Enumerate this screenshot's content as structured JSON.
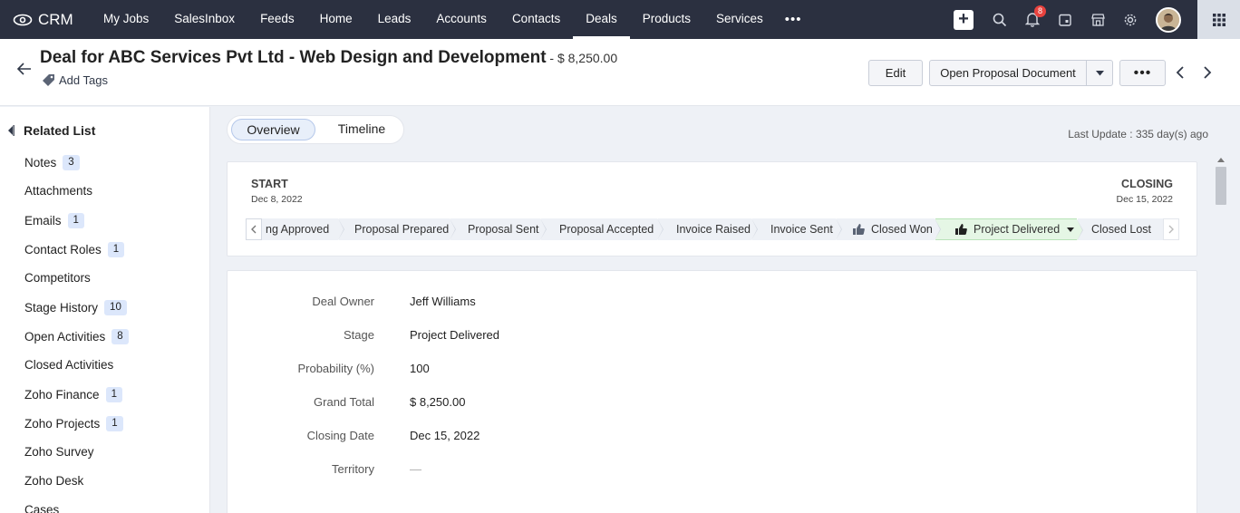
{
  "nav": {
    "brand": "CRM",
    "items": [
      "My Jobs",
      "SalesInbox",
      "Feeds",
      "Home",
      "Leads",
      "Accounts",
      "Contacts",
      "Deals",
      "Products",
      "Services"
    ],
    "active": "Deals",
    "more_label": "•••",
    "notification_count": "8",
    "icons": [
      "plus-icon",
      "search-icon",
      "bell-icon",
      "calendar-icon",
      "marketplace-icon",
      "gear-icon",
      "avatar",
      "apps-grid-icon"
    ]
  },
  "header": {
    "title": "Deal for ABC Services Pvt Ltd - Web Design and Development",
    "amount": " - $ 8,250.00",
    "add_tags": "Add Tags",
    "edit": "Edit",
    "open_proposal": "Open Proposal Document",
    "more": "•••"
  },
  "sidebar": {
    "heading": "Related List",
    "items": [
      {
        "label": "Notes",
        "count": "3"
      },
      {
        "label": "Attachments",
        "count": ""
      },
      {
        "label": "Emails",
        "count": "1"
      },
      {
        "label": "Contact Roles",
        "count": "1"
      },
      {
        "label": "Competitors",
        "count": ""
      },
      {
        "label": "Stage History",
        "count": "10"
      },
      {
        "label": "Open Activities",
        "count": "8"
      },
      {
        "label": "Closed Activities",
        "count": ""
      },
      {
        "label": "Zoho Finance",
        "count": "1"
      },
      {
        "label": "Zoho Projects",
        "count": "1"
      },
      {
        "label": "Zoho Survey",
        "count": ""
      },
      {
        "label": "Zoho Desk",
        "count": ""
      },
      {
        "label": "Cases",
        "count": ""
      }
    ]
  },
  "tabs": {
    "overview": "Overview",
    "timeline": "Timeline"
  },
  "last_update": "Last Update : 335 day(s) ago",
  "pipeline": {
    "start_label": "START",
    "start_date": "Dec 8, 2022",
    "closing_label": "CLOSING",
    "closing_date": "Dec 15, 2022",
    "stages": [
      "ng Approved",
      "Proposal Prepared",
      "Proposal Sent",
      "Proposal Accepted",
      "Invoice Raised",
      "Invoice Sent",
      "Closed Won",
      "Project Delivered",
      "Closed Lost"
    ],
    "current_stage": "Project Delivered"
  },
  "fields": [
    {
      "label": "Deal Owner",
      "value": "Jeff Williams"
    },
    {
      "label": "Stage",
      "value": "Project Delivered"
    },
    {
      "label": "Probability (%)",
      "value": "100"
    },
    {
      "label": "Grand Total",
      "value": "$ 8,250.00"
    },
    {
      "label": "Closing Date",
      "value": "Dec 15, 2022"
    },
    {
      "label": "Territory",
      "value": "—"
    }
  ]
}
